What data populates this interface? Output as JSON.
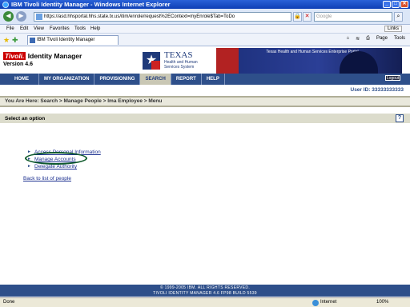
{
  "window": {
    "title": "IBM Tivoli Identity Manager - Windows Internet Explorer",
    "min": "_",
    "max": "□",
    "close": "✕"
  },
  "browser": {
    "address": "https://asd.hhsportal.hhs.state.tx.us/itim/enrole/request%2EContext=myEnrole$Tab=ToDo",
    "search_placeholder": "Google",
    "menu": [
      "File",
      "Edit",
      "View",
      "Favorites",
      "Tools",
      "Help"
    ],
    "links_label": "Links",
    "tab_title": "IBM Tivoli Identity Manager",
    "tools": [
      "Page",
      "Tools"
    ],
    "status_text": "Done",
    "zone": "Internet",
    "zoom": "100%"
  },
  "app": {
    "brand": "Tivoli.",
    "product": "Identity Manager",
    "version": "Version 4.6",
    "partner_name": "TEXAS",
    "partner_sub": "Health and Human Services System",
    "banner_title": "Texas Health and Human Services Enterprise Portal",
    "logout": "Logout",
    "nav": [
      "HOME",
      "MY ORGANIZATION",
      "PROVISIONING",
      "SEARCH",
      "REPORT",
      "HELP"
    ],
    "nav_active": "SEARCH",
    "user_id": "User ID: 33333333333",
    "breadcrumb": "You Are Here: Search > Manage People > Ima Employee > Menu",
    "option_title": "Select an option",
    "help": "?",
    "menu_items": [
      "Access Personal Information",
      "Manage Accounts",
      "Delegate Authority"
    ],
    "back_link": "Back to list of people",
    "footer_line1": "© 1999-2005 IBM. ALL RIGHTS RESERVED.",
    "footer_line2": "TIVOLI IDENTITY MANAGER 4.6 FP98 BUILD 5539"
  },
  "colors": {
    "accent": "#2e4f8a",
    "highlight_oval": "#0f5a2c"
  }
}
